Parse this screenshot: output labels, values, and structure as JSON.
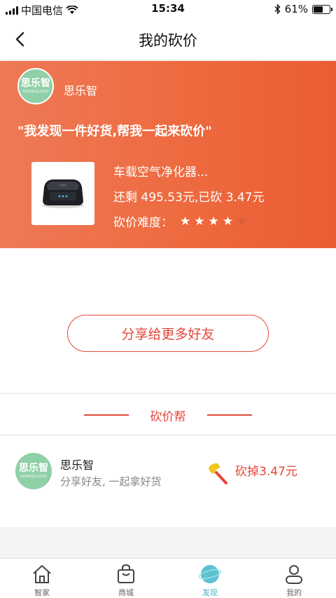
{
  "status_bar": {
    "carrier": "中国电信",
    "time": "15:34",
    "battery": "61%",
    "battery_level": 0.61
  },
  "nav": {
    "title": "我的砍价"
  },
  "card": {
    "shop_logo_text": "思乐智",
    "shop_logo_sub": "SENSOLOGY",
    "shop_name": "思乐智",
    "quote": "\"我发现一件好货,帮我一起来砍价\"",
    "product": {
      "name": "车载空气净化器...",
      "price_text": "还剩 495.53元,已砍 3.47元",
      "difficulty_label": "砍价难度：",
      "difficulty_stars": 4,
      "difficulty_max": 5
    }
  },
  "share_button": "分享给更多好友",
  "helpers_section": {
    "title": "砍价帮",
    "items": [
      {
        "avatar_text": "思乐智",
        "avatar_sub": "SENSOLOGY",
        "name": "思乐智",
        "message": "分享好友, 一起拿好货",
        "cut": "砍掉3.47元"
      }
    ]
  },
  "tabbar": {
    "tabs": [
      {
        "label": "智家",
        "icon": "home-icon"
      },
      {
        "label": "商城",
        "icon": "bag-icon"
      },
      {
        "label": "发现",
        "icon": "planet-icon",
        "active": true
      },
      {
        "label": "我的",
        "icon": "person-icon"
      }
    ]
  },
  "colors": {
    "accent": "#e4473a",
    "card_gradient_start": "#ed7a56",
    "card_gradient_end": "#eb5c33",
    "tab_active": "#3bb3c3"
  }
}
